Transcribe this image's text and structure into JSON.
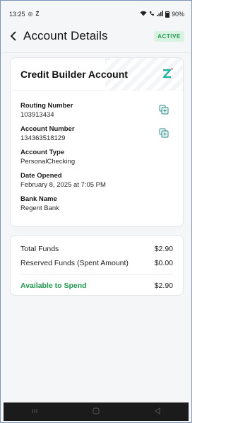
{
  "status_bar": {
    "time": "13:25",
    "battery": "90%"
  },
  "header": {
    "title": "Account Details",
    "badge": "ACTIVE"
  },
  "account_card": {
    "title": "Credit Builder Account",
    "fields": [
      {
        "label": "Routing Number",
        "value": "103913434"
      },
      {
        "label": "Account Number",
        "value": "134363518129"
      },
      {
        "label": "Account Type",
        "value": "PersonalChecking"
      },
      {
        "label": "Date Opened",
        "value": "February 8, 2025 at 7:05 PM"
      },
      {
        "label": "Bank Name",
        "value": "Regent Bank"
      }
    ]
  },
  "funds": {
    "total_label": "Total Funds",
    "total_value": "$2.90",
    "reserved_label": "Reserved Funds (Spent Amount)",
    "reserved_value": "$0.00",
    "available_label": "Available to Spend",
    "available_value": "$2.90"
  },
  "colors": {
    "accent_green": "#1f9a4d",
    "badge_bg": "#d9f3e2",
    "logo_teal": "#1fb5a3"
  }
}
